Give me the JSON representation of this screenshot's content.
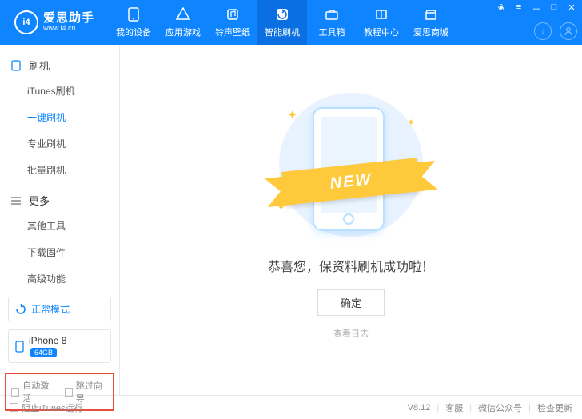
{
  "brand": {
    "name": "爱思助手",
    "url": "www.i4.cn",
    "logo": "i4"
  },
  "nav": [
    {
      "label": "我的设备",
      "icon": "phone"
    },
    {
      "label": "应用游戏",
      "icon": "apps"
    },
    {
      "label": "铃声壁纸",
      "icon": "music"
    },
    {
      "label": "智能刷机",
      "icon": "flash",
      "active": true
    },
    {
      "label": "工具箱",
      "icon": "toolbox"
    },
    {
      "label": "教程中心",
      "icon": "book"
    },
    {
      "label": "爱思商城",
      "icon": "shop"
    }
  ],
  "sidebar": {
    "groups": [
      {
        "label": "刷机",
        "icon": "phone-sq",
        "items": [
          {
            "label": "iTunes刷机"
          },
          {
            "label": "一键刷机",
            "active": true
          },
          {
            "label": "专业刷机"
          },
          {
            "label": "批量刷机"
          }
        ]
      },
      {
        "label": "更多",
        "icon": "list",
        "items": [
          {
            "label": "其他工具"
          },
          {
            "label": "下载固件"
          },
          {
            "label": "高级功能"
          }
        ]
      }
    ],
    "mode": {
      "label": "正常模式"
    },
    "device": {
      "name": "iPhone 8",
      "storage": "64GB"
    },
    "checks": [
      {
        "label": "自动激活"
      },
      {
        "label": "跳过向导"
      }
    ]
  },
  "main": {
    "ribbon": "NEW",
    "message": "恭喜您，保资料刷机成功啦！",
    "ok": "确定",
    "log": "查看日志"
  },
  "footer": {
    "block_itunes": "阻止iTunes运行",
    "version": "V8.12",
    "links": [
      "客服",
      "微信公众号",
      "检查更新"
    ]
  }
}
